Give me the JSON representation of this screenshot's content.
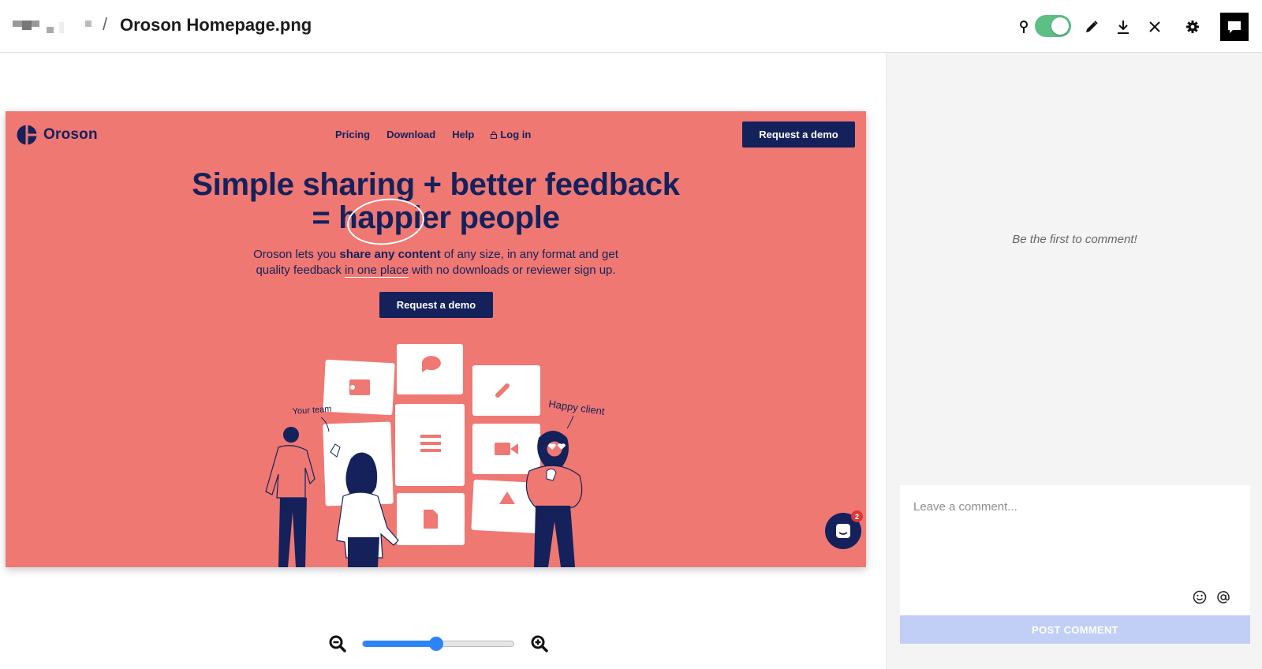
{
  "header": {
    "file_name": "Oroson Homepage.png",
    "separator": "/",
    "comment_pins_enabled": true
  },
  "preview": {
    "brand_name": "Oroson",
    "nav": [
      "Pricing",
      "Download",
      "Help",
      "Log in"
    ],
    "cta_label": "Request a demo",
    "headline_line1": "Simple sharing + better feedback",
    "headline_line2": "= happier people",
    "sub_line1_a": "Oroson lets you ",
    "sub_line1_b": "share any content",
    "sub_line1_c": " of any size, in any format and get",
    "sub_line2_a": "quality feedback ",
    "sub_line2_b": "in one place",
    "sub_line2_c": " with no downloads or reviewer sign up.",
    "label_team": "Your team",
    "label_client": "Happy client",
    "chat_badge": "2",
    "colors": {
      "background": "#ef7873",
      "navy": "#14215b"
    }
  },
  "zoom": {
    "level": 0.48
  },
  "comments": {
    "empty_message": "Be the first to comment!",
    "placeholder": "Leave a comment...",
    "post_label": "POST COMMENT"
  }
}
